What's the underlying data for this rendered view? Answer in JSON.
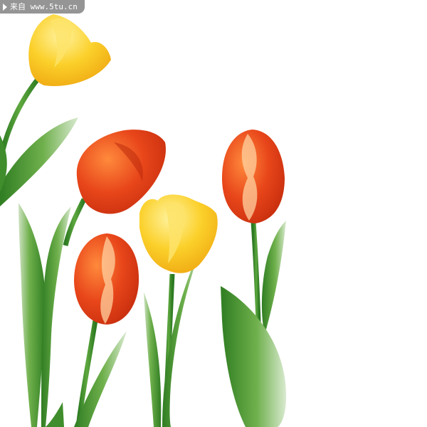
{
  "watermark": {
    "text": "来自 www.5tu.cn",
    "icon": "play-arrow-icon"
  },
  "scene": {
    "subject": "tulips",
    "colors": {
      "background": "#ffffff",
      "red_tulip": "#e84a12",
      "yellow_tulip": "#f7c21a",
      "stem_leaf": "#4e9a33"
    }
  }
}
